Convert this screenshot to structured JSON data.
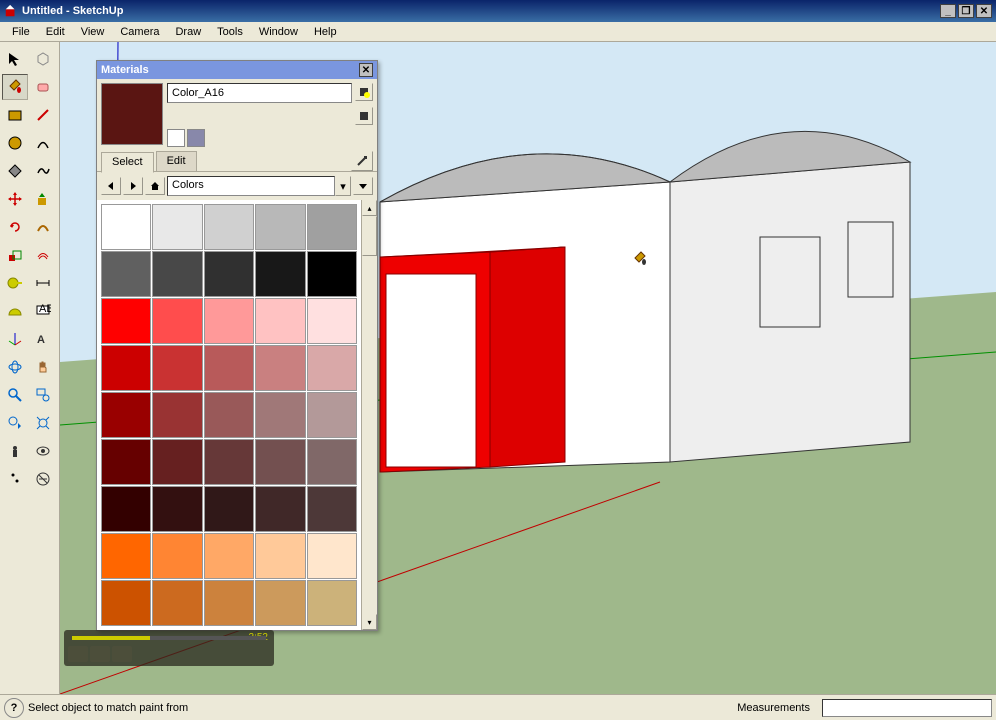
{
  "window": {
    "title": "Untitled - SketchUp"
  },
  "menubar": [
    "File",
    "Edit",
    "View",
    "Camera",
    "Draw",
    "Tools",
    "Window",
    "Help"
  ],
  "materials": {
    "panel_title": "Materials",
    "material_name": "Color_A16",
    "preview_color": "#5a1512",
    "tabs": {
      "select": "Select",
      "edit": "Edit"
    },
    "library": "Colors",
    "swatches": [
      "#ffffff",
      "#e8e8e8",
      "#d0d0d0",
      "#b8b8b8",
      "#a0a0a0",
      "#606060",
      "#484848",
      "#303030",
      "#181818",
      "#000000",
      "#ff0000",
      "#ff4d4d",
      "#ff9999",
      "#ffc2c2",
      "#ffe0e0",
      "#cc0000",
      "#c93232",
      "#b85a5a",
      "#c98080",
      "#d9a8a8",
      "#990000",
      "#993333",
      "#995959",
      "#a07878",
      "#b39999",
      "#660000",
      "#662020",
      "#663838",
      "#735050",
      "#806868",
      "#330000",
      "#331010",
      "#301818",
      "#402828",
      "#4d3838",
      "#ff6600",
      "#ff8533",
      "#ffa866",
      "#ffc999",
      "#ffe6cc",
      "#cc5200",
      "#cc6a1f",
      "#cc823d",
      "#cc9a5c",
      "#ccb27a"
    ]
  },
  "statusbar": {
    "hint": "Select object to match paint from",
    "measurements_label": "Measurements"
  },
  "video": {
    "time": "2:52"
  },
  "colors": {
    "sky": "#d4e8f5",
    "ground": "#9fb88b"
  }
}
